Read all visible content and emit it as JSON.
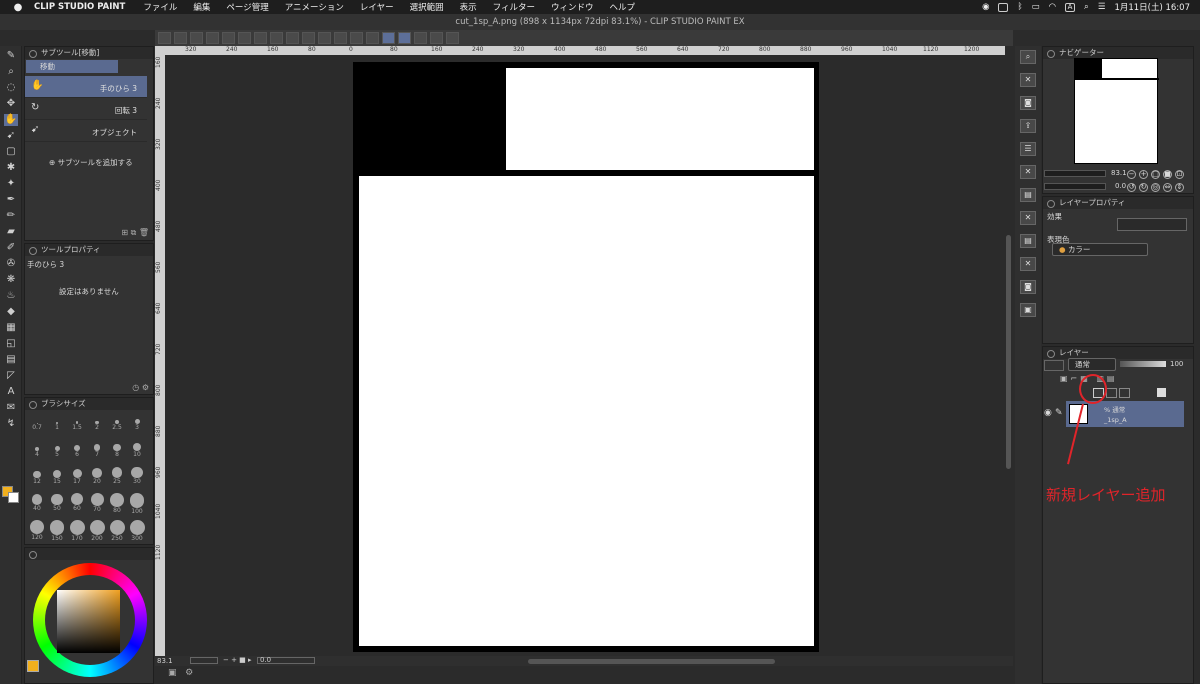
{
  "menubar": {
    "app_name": "CLIP STUDIO PAINT",
    "items": [
      "ファイル",
      "編集",
      "ページ管理",
      "アニメーション",
      "レイヤー",
      "選択範囲",
      "表示",
      "フィルター",
      "ウィンドウ",
      "ヘルプ"
    ],
    "ime": "A",
    "clock": "1月11日(土) 16:07"
  },
  "window": {
    "title": "cut_1sp_A.png (898 x 1134px 72dpi 83.1%)  - CLIP STUDIO PAINT EX"
  },
  "ruler": {
    "top": [
      "320",
      "240",
      "160",
      "80",
      "0",
      "80",
      "160",
      "240",
      "320",
      "400",
      "480",
      "560",
      "640",
      "720",
      "800",
      "880",
      "960",
      "1040",
      "1120",
      "1200"
    ],
    "left": [
      "160",
      "240",
      "320",
      "400",
      "480",
      "560",
      "640",
      "720",
      "800",
      "880",
      "960",
      "1040",
      "1120"
    ]
  },
  "subtool_panel": {
    "title": "サブツール[移動]",
    "tab": "移動",
    "items": [
      {
        "label": "手のひら 3"
      },
      {
        "label": "回転 3"
      },
      {
        "label": "オブジェクト"
      }
    ],
    "add_label": "サブツールを追加する"
  },
  "tool_property": {
    "title": "ツールプロパティ",
    "tool_name": "手のひら 3",
    "empty_message": "設定はありません"
  },
  "brush_size": {
    "title": "ブラシサイズ",
    "sizes": [
      "0.7",
      "1",
      "1.5",
      "2",
      "2.5",
      "3",
      "4",
      "5",
      "6",
      "7",
      "8",
      "10",
      "12",
      "15",
      "17",
      "20",
      "25",
      "30",
      "40",
      "50",
      "60",
      "70",
      "80",
      "100",
      "120",
      "150",
      "170",
      "200",
      "250",
      "300"
    ]
  },
  "status": {
    "zoom": "83.1",
    "angle": "0.0"
  },
  "navigator": {
    "title": "ナビゲーター",
    "zoom": "83.1",
    "rotation": "0.0"
  },
  "layer_property": {
    "title": "レイヤープロパティ",
    "effect_label": "効果",
    "expression_label": "表現色",
    "expression_value": "カラー"
  },
  "layers": {
    "title": "レイヤー",
    "blend_mode": "通常",
    "opacity": "100",
    "rows": [
      {
        "mode": "% 通常",
        "name": "_1sp_A"
      }
    ]
  },
  "annotation": {
    "text": "新規レイヤー追加",
    "color": "#e0242a"
  },
  "colors": {
    "main": "#f2b01e",
    "sub": "#ffffff"
  }
}
